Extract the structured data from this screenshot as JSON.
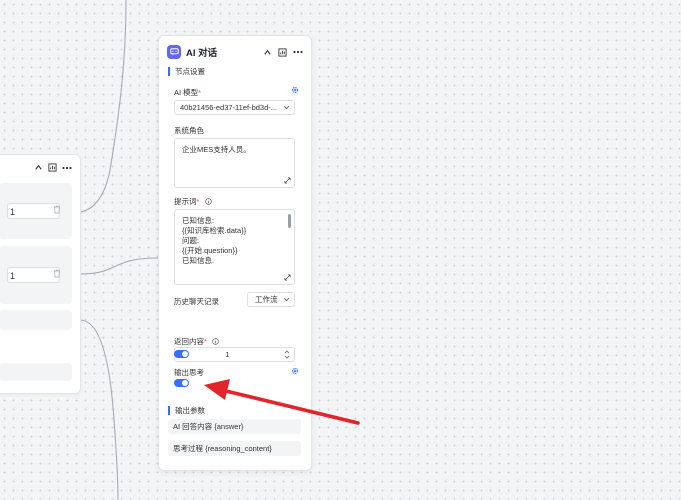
{
  "ai_node": {
    "title": "AI 对话",
    "node_settings_title": "节点设置",
    "model": {
      "label": "AI 模型",
      "required": "*",
      "value": "40b21456-ed37-11ef-bd3d-..."
    },
    "system_role": {
      "label": "系统角色",
      "value": "企业MES支持人员。"
    },
    "prompt": {
      "label": "提示词",
      "required": "*",
      "value": "已知信息:\n{{知识库检索.data}}\n问题:\n{{开始.question}}\n已知信息."
    },
    "history": {
      "label": "历史聊天记录",
      "select_value": "工作流",
      "count": "1"
    },
    "return_content": {
      "label": "返回内容",
      "required": "*",
      "enabled": true
    },
    "output_thinking": {
      "label": "输出思考",
      "enabled": true
    },
    "output_params_title": "输出参数",
    "output_params": [
      {
        "label": "AI 回答内容 {answer}"
      },
      {
        "label": "思考过程 {reasoning_content}"
      }
    ]
  },
  "left_node": {
    "inputs": [
      "1",
      "1"
    ]
  },
  "colors": {
    "accent": "#3370ff",
    "node_logo": "#6366f1",
    "annotation_arrow": "#e3242b"
  }
}
